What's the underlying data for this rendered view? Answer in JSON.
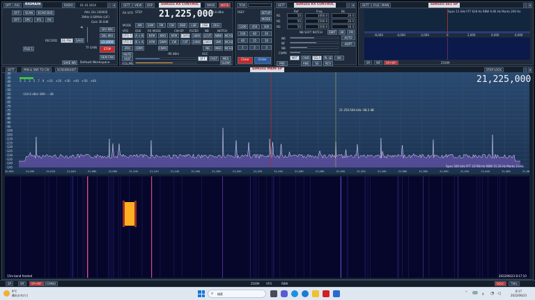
{
  "left_panel": {
    "tabs": [
      "OPT",
      "RIG",
      "RIGMAIN",
      "RADIO"
    ],
    "freq_tag": "01.43.1814",
    "buttons_row1": [
      "OFF",
      "SCAN",
      "ECHO BUS"
    ],
    "buttons_row2": [
      "OFF",
      "SPC",
      "IFS",
      "RX"
    ],
    "info": [
      "Attn 24s  100000",
      "2MHz  0.60MHz (LIF)",
      "Gain 36.0dB"
    ],
    "mid_buttons": [
      "RECORD",
      "BS PSK",
      "SAVE"
    ],
    "tfp_gain": "TF GAIN",
    "side_buttons": [
      "DIV MIX",
      "DEL MIX",
      "L1 LOCK",
      "STOP",
      "REM FAN"
    ],
    "bottom_buttons": [
      "SAVE WA",
      "Default Workspace"
    ],
    "left_small": "FILE 1"
  },
  "center_panel": {
    "tabs": [
      "SETT",
      "VIEW",
      "DSP"
    ],
    "title": "SDRuno  RX CONTROL",
    "wave_tabs": [
      "WAVE",
      "NOTE"
    ],
    "freq_label": "RX VFO",
    "step_label": "STEP",
    "frequency": "21,225,000",
    "dbm": "-120.8 dBm",
    "mode_row": [
      "AM",
      "SAM",
      "FM",
      "CW",
      "DSB",
      "LSB",
      "USB",
      "DIGI"
    ],
    "row_headers": [
      "VFO",
      "QSK",
      "RX MODE",
      "CW-OP",
      "FILTER",
      "NB",
      "NOTCH"
    ],
    "grid_rows": [
      [
        "VFO A",
        "A > B",
        "NFM",
        "NRO",
        "NFM",
        "CWFB",
        "1800",
        "LCUT",
        "NBW",
        "NCH1"
      ],
      [
        "VFO B",
        "B > A",
        "AFM",
        "SWM",
        "CW",
        "CAT",
        "2400",
        "2800",
        "SNR",
        "NCH2"
      ],
      [
        "ZRO",
        "QRM",
        "CWAC",
        "",
        "NB",
        "MED",
        "NCH3"
      ]
    ],
    "mute": "MUTE",
    "volume_label": "VOLUME",
    "agc": [
      "OFF",
      "FAST",
      "MED",
      "SLOW"
    ],
    "sq_label": "SQLT",
    "sql_level": "-90 dBm",
    "keypad_title": "FKEY",
    "keypad": [
      "1200",
      "450",
      "300",
      "100",
      "60",
      "20",
      "40",
      "15",
      "10",
      "1",
      "2",
      "3"
    ],
    "tcw": "TCW",
    "clear": "Clear",
    "enter": "Enter"
  },
  "rx_ctl_panel": {
    "title": "SDRuno  RX CONTROL",
    "col_headers": [
      "Ref",
      "Freq",
      "Bk"
    ],
    "rows": [
      {
        "label": "N1",
        "a": "50",
        "b": "1000.0",
        "c": "20.0"
      },
      {
        "label": "N2",
        "a": "50",
        "b": "1500.0",
        "c": "20.0"
      },
      {
        "label": "N3",
        "a": "50",
        "b": "1500.0",
        "c": "20.0"
      }
    ],
    "slider_labels": [
      "NB SOFT NOTCH",
      "NR",
      "NF",
      "NB",
      "CWPK"
    ],
    "small_buttons": [
      "SWIT",
      "4K",
      "FM"
    ],
    "mode_buttons": [
      "MRT",
      "CWD",
      "SELA",
      "PL LE",
      "KA"
    ],
    "ch_buttons": [
      "PRE DE",
      "ANS",
      "SS",
      "RCV"
    ],
    "pbs": [
      "MULTI",
      "MAX"
    ]
  },
  "top_spectrum": {
    "tabs": [
      "SETT",
      "FILE",
      "MAIN"
    ],
    "title": "SDRuno  SS1 SP",
    "info": "Span 12 kHz  FFT 628 Hz  RBW 9.66 Hz  Marks 200 Hz",
    "axis": [
      "-6,000",
      "-4,000",
      "-2,000",
      "0",
      "2,000",
      "4,000",
      "6,000"
    ],
    "footer_left": [
      "SP",
      "WF",
      "SP+WF"
    ],
    "zoom": "ZOOM"
  },
  "main_spectrum": {
    "tabs": [
      "SETT",
      "PAN & SNR TO CW",
      "SCREENSHOT"
    ],
    "title": "SDRuno  MAIN SP",
    "step_lock": "STEP LOCK",
    "frequency": "21,225,000",
    "signal_info": "-104.6 dBm  SNR: -- dB",
    "marker_label": "21 250.504 kHz  -68.2 dB",
    "bottom_info": "Span 500 kHz  FFT 32768 Hz  RBW 15.26 Hz  Marks 2 kHz",
    "y_axis": [
      "-30",
      "-35",
      "-40",
      "-45",
      "-50",
      "-55",
      "-60",
      "-65",
      "-70",
      "-75",
      "-80",
      "-85",
      "-90",
      "-95",
      "-100",
      "-105",
      "-110",
      "-115",
      "-120",
      "-125",
      "-130",
      "-135",
      "-140",
      "-145"
    ],
    "x_axis": [
      "20,950",
      "21,000",
      "21,020",
      "21,040",
      "21,060",
      "21,080",
      "21,100",
      "21,120",
      "21,140",
      "21,160",
      "21,180",
      "21,200",
      "21,220",
      "21,240",
      "21,260",
      "21,280",
      "21,300",
      "21,320",
      "21,340",
      "21,360",
      "21,380",
      "21,400",
      "21,420",
      "21,440",
      "21,460",
      "21,480"
    ],
    "scale_labels": [
      "S",
      "1",
      "3",
      "5",
      "7",
      "9",
      "+10",
      "+20",
      "+30",
      "+40",
      "+50",
      "+60"
    ]
  },
  "waterfall": {
    "left_label": "15m band fronted",
    "right_label": "2022/06/23 8:17:10"
  },
  "status_strip": {
    "left": [
      "SP",
      "WF",
      "SP+WF",
      "COMBO"
    ],
    "center": [
      "ZOOM",
      "VFO",
      "RBW"
    ],
    "right": [
      "SQLC",
      "TWIL"
    ]
  },
  "taskbar": {
    "weather_temp": "9°C",
    "weather_desc": "晴れのち(り)",
    "search_placeholder": "検索",
    "time": "8:17",
    "date": "2022/06/23",
    "ime": "A"
  },
  "colors": {
    "accent": "#5a86b0",
    "spectrum_fill": "#5d4fa0",
    "spectrum_line": "#e6e6ff",
    "waterfall_bg": "#06062a",
    "signal": "#ffb020",
    "title_red": "#b02020"
  }
}
